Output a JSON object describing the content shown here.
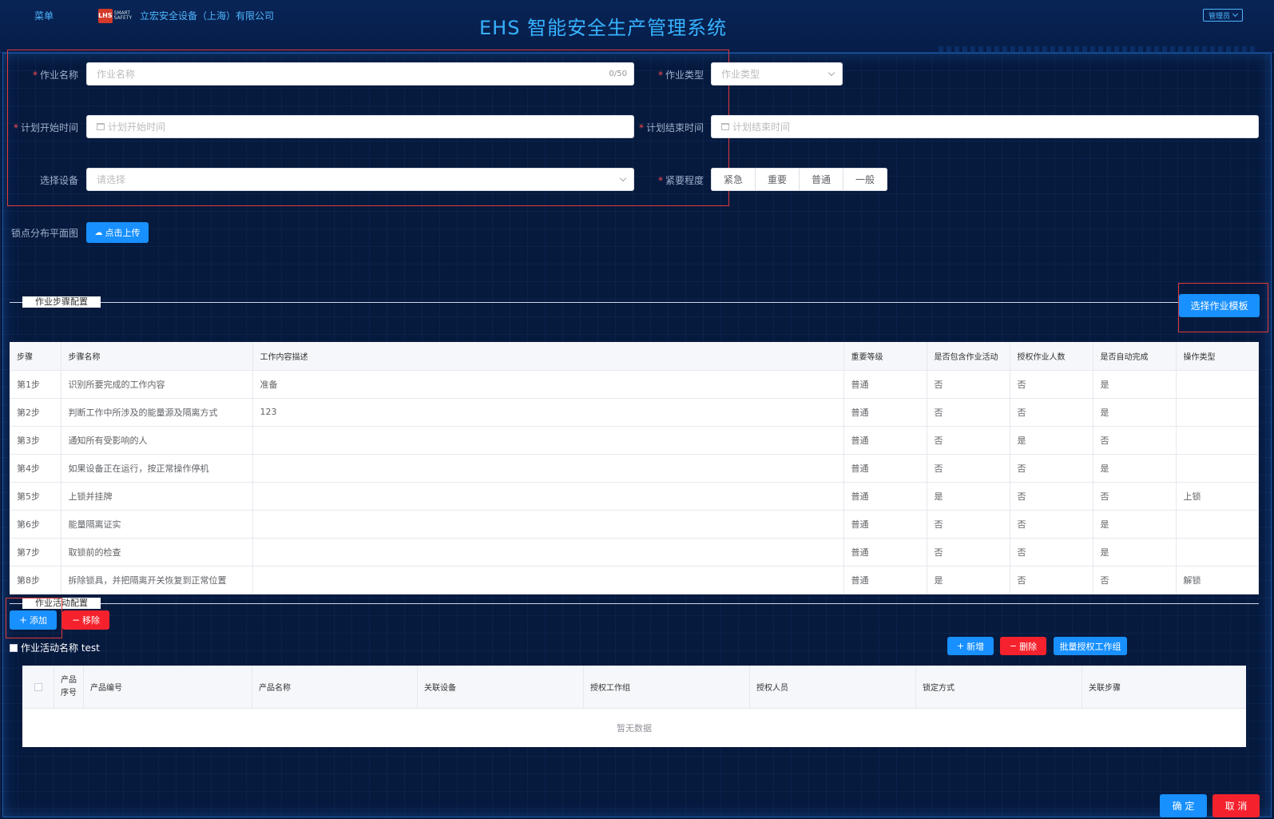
{
  "header": {
    "menu": "菜单",
    "logo_mark": "LHS",
    "logo_text": "SMART SAFETY",
    "company": "立宏安全设备（上海）有限公司",
    "title": "EHS 智能安全生产管理系统",
    "user": "管理员"
  },
  "form": {
    "job_name": {
      "label": "作业名称",
      "placeholder": "作业名称",
      "counter": "0/50"
    },
    "job_type": {
      "label": "作业类型",
      "placeholder": "作业类型"
    },
    "plan_start": {
      "label": "计划开始时间",
      "placeholder": "计划开始时间"
    },
    "plan_end": {
      "label": "计划结束时间",
      "placeholder": "计划结束时间"
    },
    "device": {
      "label": "选择设备",
      "placeholder": "请选择"
    },
    "urgency": {
      "label": "紧要程度",
      "options": [
        "紧急",
        "重要",
        "普通",
        "一般"
      ]
    },
    "lock_map": {
      "label": "锁点分布平面图",
      "button": "点击上传"
    }
  },
  "steps_section": {
    "title": "作业步骤配置",
    "select_template": "选择作业模板",
    "columns": [
      "步骤",
      "步骤名称",
      "工作内容描述",
      "重要等级",
      "是否包含作业活动",
      "授权作业人数",
      "是否自动完成",
      "操作类型"
    ],
    "rows": [
      [
        "第1步",
        "识别所要完成的工作内容",
        "准备",
        "普通",
        "否",
        "否",
        "是",
        ""
      ],
      [
        "第2步",
        "判断工作中所涉及的能量源及隔离方式",
        "123",
        "普通",
        "否",
        "否",
        "是",
        ""
      ],
      [
        "第3步",
        "通知所有受影响的人",
        "",
        "普通",
        "否",
        "是",
        "否",
        ""
      ],
      [
        "第4步",
        "如果设备正在运行，按正常操作停机",
        "",
        "普通",
        "否",
        "否",
        "是",
        ""
      ],
      [
        "第5步",
        "上锁并挂牌",
        "",
        "普通",
        "是",
        "否",
        "否",
        "上锁"
      ],
      [
        "第6步",
        "能量隔离证实",
        "",
        "普通",
        "否",
        "否",
        "是",
        ""
      ],
      [
        "第7步",
        "取锁前的检查",
        "",
        "普通",
        "否",
        "否",
        "是",
        ""
      ],
      [
        "第8步",
        "拆除锁具，并把隔离开关恢复到正常位置",
        "",
        "普通",
        "是",
        "否",
        "否",
        "解锁"
      ]
    ]
  },
  "activity_section": {
    "title": "作业活动配置",
    "add": "添加",
    "remove": "移除",
    "activity_name": "作业活动名称 test",
    "new": "新增",
    "delete": "删除",
    "batch_auth": "批量授权工作组",
    "columns": [
      "产品序号",
      "产品编号",
      "产品名称",
      "关联设备",
      "授权工作组",
      "授权人员",
      "锁定方式",
      "关联步骤"
    ],
    "empty": "暂无数据"
  },
  "footer": {
    "confirm": "确 定",
    "cancel": "取 消"
  }
}
